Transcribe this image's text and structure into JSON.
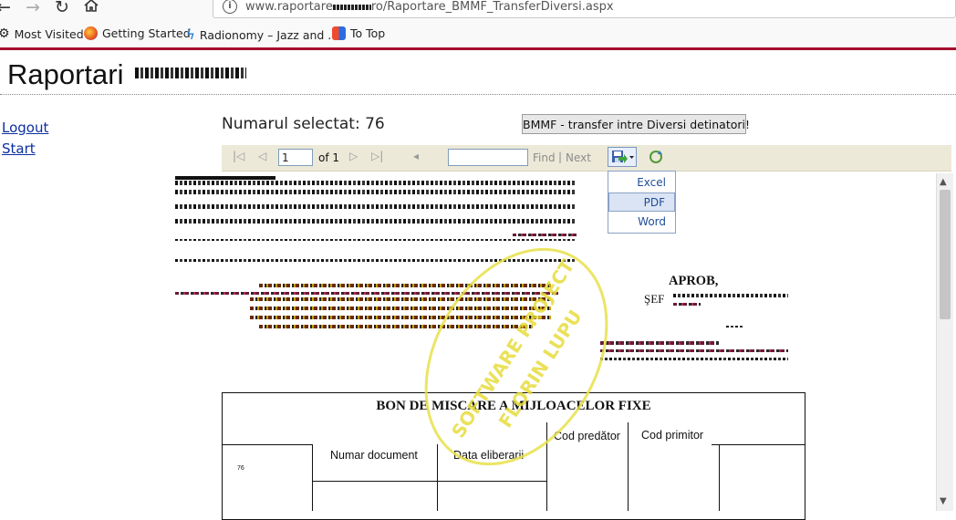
{
  "browser": {
    "url_prefix": "www.raportare",
    "url_suffix": "ro/Raportare_BMMF_TransferDiversi.aspx",
    "bookmarks": [
      {
        "label": "Most Visited",
        "icon": "gear-icon"
      },
      {
        "label": "Getting Started",
        "icon": "firefox-icon"
      },
      {
        "label": "Radionomy – Jazz and ...",
        "icon": "bolt-icon"
      },
      {
        "label": "To Top",
        "icon": "totop-icon"
      }
    ]
  },
  "page": {
    "site_title": "Raportari",
    "nav": {
      "logout": "Logout",
      "start": "Start"
    },
    "selected_label": "Numarul selectat: 76",
    "transfer_button": "BMMF - transfer intre Diversi detinatori!"
  },
  "toolbar": {
    "page_value": "1",
    "of_pages": "of 1",
    "find_label": "Find",
    "separator": "|",
    "next_label": "Next"
  },
  "export_menu": {
    "items": [
      "Excel",
      "PDF",
      "Word"
    ],
    "highlighted": "PDF"
  },
  "report": {
    "aprob": "APROB,",
    "sef": "ŞEF",
    "doc_title": "BON DE MISCARE A MIJLOACELOR FIXE",
    "cod_predator": "Cod predător",
    "cod_primitor": "Cod primitor",
    "numar_document": "Numar document",
    "data_eliberarii": "Data eliberarii",
    "row_value": "76"
  },
  "watermark": {
    "line1": "SOFTWARE PROJECT",
    "line2": "FLORIN LUPU"
  },
  "colors": {
    "accent": "#a50f2d",
    "toolbar_bg": "#ece9d8",
    "link": "#0b2fa0",
    "watermark": "#e8e04a"
  }
}
